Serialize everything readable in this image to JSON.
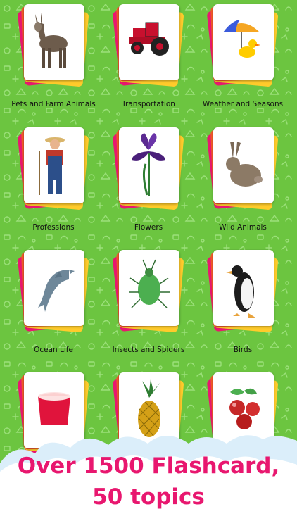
{
  "topics": [
    {
      "label": "Pets and Farm Animals",
      "icon": "donkey-icon"
    },
    {
      "label": "Transportation",
      "icon": "tractor-icon"
    },
    {
      "label": "Weather and Seasons",
      "icon": "umbrella-duck-icon"
    },
    {
      "label": "Professions",
      "icon": "farmer-icon"
    },
    {
      "label": "Flowers",
      "icon": "iris-flower-icon"
    },
    {
      "label": "Wild Animals",
      "icon": "rabbit-icon"
    },
    {
      "label": "Ocean Life",
      "icon": "dolphin-icon"
    },
    {
      "label": "Insects and Spiders",
      "icon": "green-bug-icon"
    },
    {
      "label": "Birds",
      "icon": "penguin-icon"
    },
    {
      "label": "",
      "icon": "yogurt-cup-icon"
    },
    {
      "label": "",
      "icon": "pineapple-icon"
    },
    {
      "label": "",
      "icon": "rose-hip-berries-icon"
    }
  ],
  "headline": {
    "line1": "Over 1500 Flashcard,",
    "line2": "50 topics"
  },
  "colors": {
    "background": "#6cc540",
    "headline": "#e8176f",
    "card_stack": [
      "#e8176f",
      "#ffcb2b",
      "#f25b2a"
    ]
  }
}
